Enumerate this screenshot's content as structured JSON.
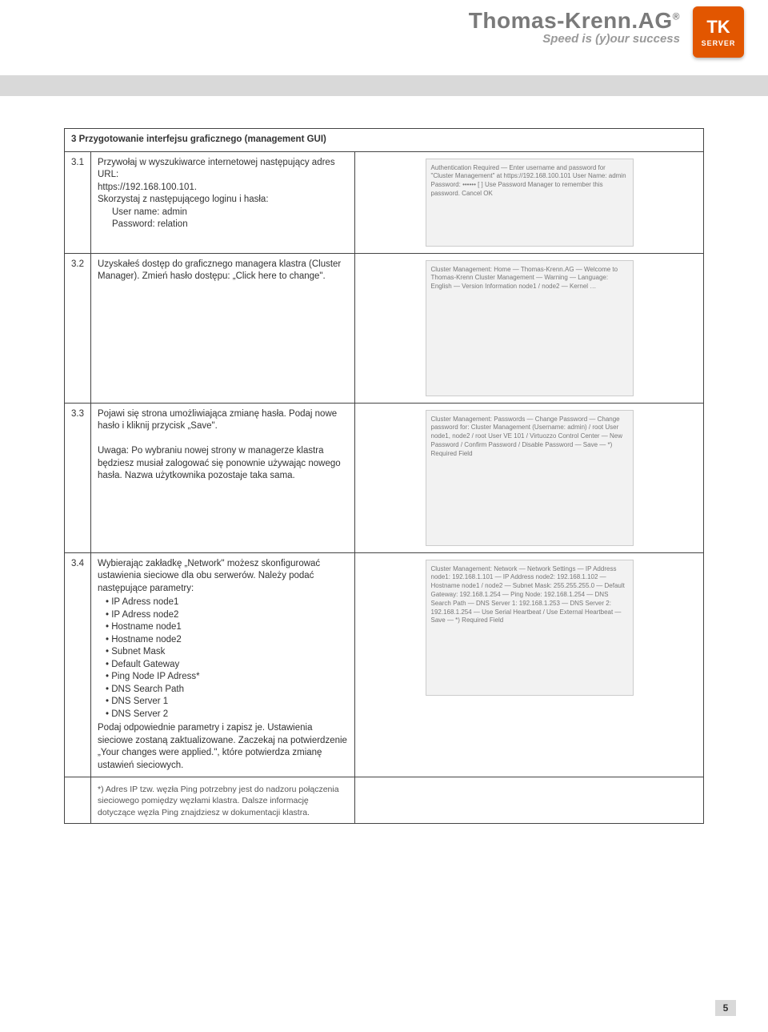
{
  "header": {
    "brand": "Thomas-Krenn.AG",
    "reg": "®",
    "tagline": "Speed is (y)our success",
    "badge_top": "TK",
    "badge_bottom": "SERVER"
  },
  "section": {
    "num": "3",
    "title": "Przygotowanie interfejsu graficznego (management GUI)"
  },
  "rows": {
    "r1": {
      "num": "3.1",
      "p1": "Przywołaj w wyszukiwarce internetowej następujący adres URL:",
      "url": "https://192.168.100.101.",
      "p2": "Skorzystaj z następującego loginu i hasła:",
      "user_label": "User name: admin",
      "pass_label": "Password: relation",
      "thumb_hint": "Authentication Required — Enter username and password for \"Cluster Management\" at https://192.168.100.101  User Name: admin  Password: ••••••  [ ] Use Password Manager to remember this password.  Cancel  OK"
    },
    "r2": {
      "num": "3.2",
      "p1": "Uzyskałeś dostęp do graficznego managera klastra (Cluster Manager). Zmień hasło dostępu: „Click here to change\".",
      "thumb_hint": "Cluster Management: Home — Thomas-Krenn.AG — Welcome to Thomas-Krenn Cluster Management — Warning — Language: English — Version Information node1 / node2 — Kernel …"
    },
    "r3": {
      "num": "3.3",
      "p1": "Pojawi się strona umożliwiająca zmianę hasła. Podaj nowe hasło i kliknij przycisk „Save\".",
      "uwaga_label": "Uwaga:",
      "uwaga_body": " Po wybraniu nowej strony w managerze klastra będziesz musiał zalogować się ponownie używając nowego hasła. Nazwa użytkownika pozostaje taka sama.",
      "thumb_hint": "Cluster Management: Passwords — Change Password — Change password for: Cluster Management (Username: admin) / root User node1, node2 / root User VE 101 / Virtuozzo Control Center — New Password / Confirm Password / Disable Password — Save — *) Required Field"
    },
    "r4": {
      "num": "3.4",
      "p1": "Wybierając zakładkę „Network\" możesz skonfigurować ustawienia sieciowe dla obu serwerów. Należy podać następujące parametry:",
      "params": [
        "IP Adress node1",
        "IP Adress node2",
        "Hostname node1",
        "Hostname node2",
        "Subnet Mask",
        "Default Gateway",
        "Ping Node IP Adress*",
        "DNS Search Path",
        "DNS Server 1",
        "DNS Server 2"
      ],
      "p2": "Podaj odpowiednie parametry i zapisz je. Ustawienia sieciowe zostaną zaktualizowane. Zaczekaj na potwierdzenie „Your changes were applied.\", które potwierdza zmianę ustawień sieciowych.",
      "footnote": "*) Adres IP tzw. węzła Ping potrzebny jest do nadzoru połączenia sieciowego pomiędzy węzłami klastra. Dalsze informację dotyczące węzła Ping znajdziesz w dokumentacji klastra.",
      "thumb_hint": "Cluster Management: Network — Network Settings — IP Address node1: 192.168.1.101 — IP Address node2: 192.168.1.102 — Hostname node1 / node2 — Subnet Mask: 255.255.255.0 — Default Gateway: 192.168.1.254 — Ping Node: 192.168.1.254 — DNS Search Path — DNS Server 1: 192.168.1.253 — DNS Server 2: 192.168.1.254 — Use Serial Heartbeat / Use External Heartbeat — Save — *) Required Field"
    }
  },
  "page_number": "5"
}
